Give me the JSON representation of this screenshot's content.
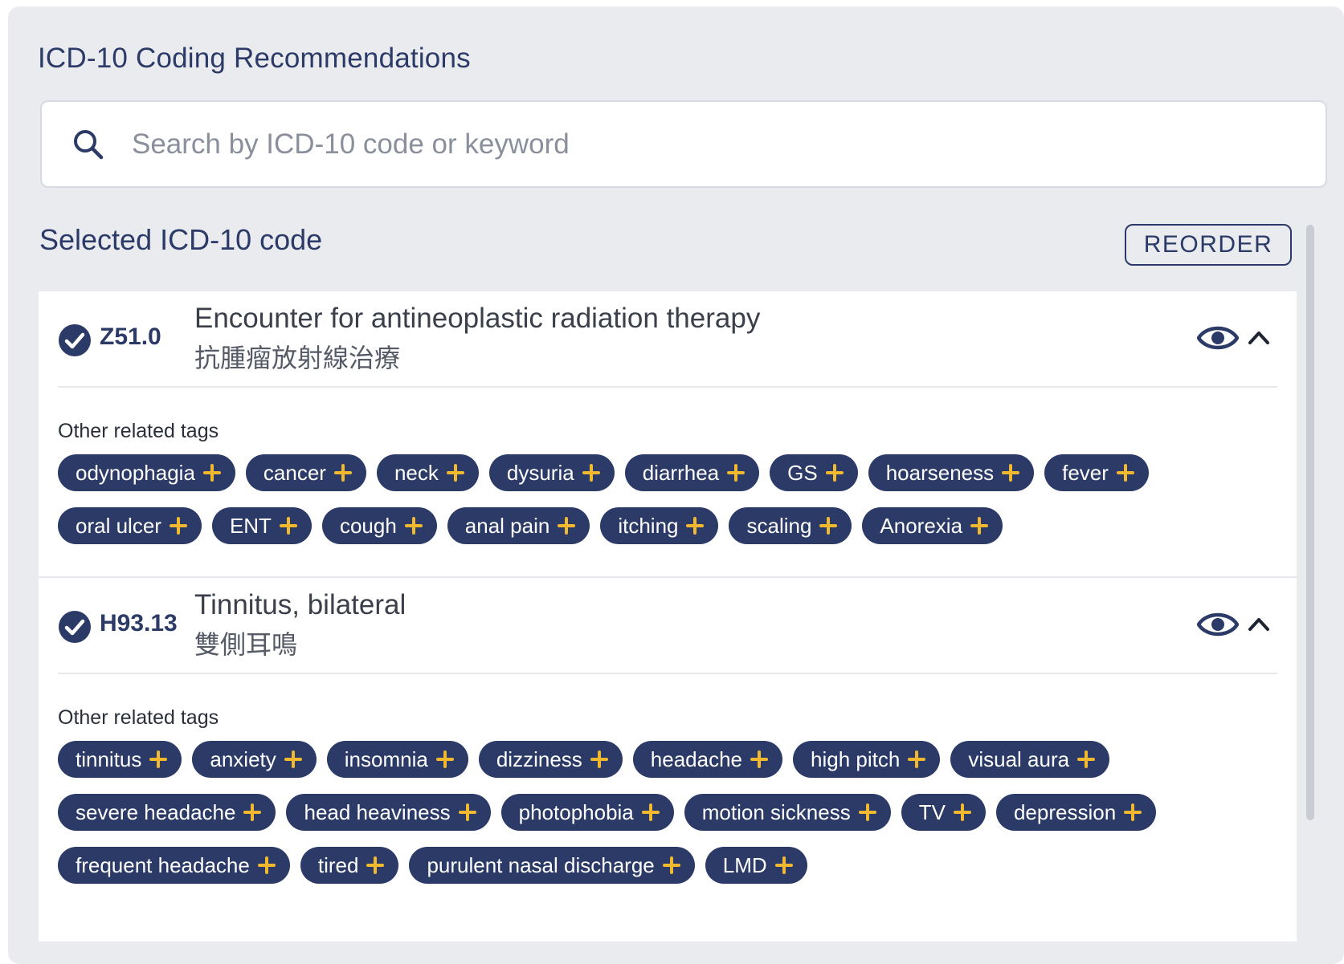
{
  "panel": {
    "title": "ICD-10 Coding Recommendations"
  },
  "search": {
    "placeholder": "Search by ICD-10 code or keyword",
    "value": ""
  },
  "selected": {
    "title": "Selected ICD-10 code",
    "reorder_label": "REORDER"
  },
  "colors": {
    "accent": "#2b3a67",
    "tag_plus": "#f2b92f",
    "panel_bg": "#e9ebef"
  },
  "codes": [
    {
      "code": "Z51.0",
      "name_en": "Encounter for antineoplastic radiation therapy",
      "name_zh": "抗腫瘤放射線治療",
      "tags_label": "Other related tags",
      "tags": [
        "odynophagia",
        "cancer",
        "neck",
        "dysuria",
        "diarrhea",
        "GS",
        "hoarseness",
        "fever",
        "oral ulcer",
        "ENT",
        "cough",
        "anal pain",
        "itching",
        "scaling",
        "Anorexia"
      ]
    },
    {
      "code": "H93.13",
      "name_en": "Tinnitus, bilateral",
      "name_zh": "雙側耳鳴",
      "tags_label": "Other related tags",
      "tags": [
        "tinnitus",
        "anxiety",
        "insomnia",
        "dizziness",
        "headache",
        "high pitch",
        "visual aura",
        "severe headache",
        "head heaviness",
        "photophobia",
        "motion sickness",
        "TV",
        "depression",
        "frequent headache",
        "tired",
        "purulent nasal discharge",
        "LMD"
      ]
    }
  ]
}
